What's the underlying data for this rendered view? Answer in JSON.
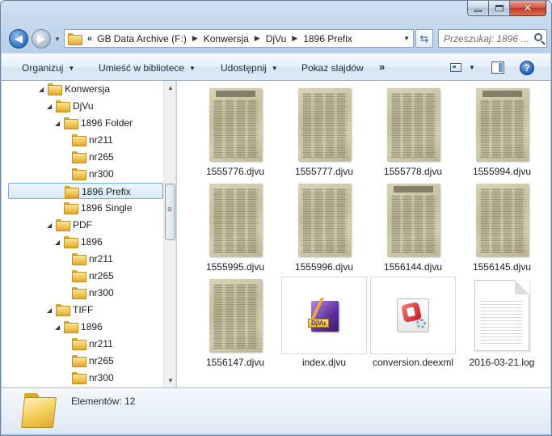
{
  "address": {
    "crumbs": [
      "GB Data Archive (F:)",
      "Konwersja",
      "DjVu",
      "1896 Prefix"
    ]
  },
  "search": {
    "placeholder": "Przeszukaj: 1896 ..."
  },
  "toolbar": {
    "organize": "Organizuj",
    "include_library": "Umieść w bibliotece",
    "share": "Udostępnij",
    "slideshow": "Pokaz slajdów"
  },
  "tree": [
    {
      "label": "Konwersja",
      "level": 0,
      "expanded": true
    },
    {
      "label": "DjVu",
      "level": 1,
      "expanded": true
    },
    {
      "label": "1896 Folder",
      "level": 2,
      "expanded": true
    },
    {
      "label": "nr211",
      "level": 3
    },
    {
      "label": "nr265",
      "level": 3
    },
    {
      "label": "nr300",
      "level": 3
    },
    {
      "label": "1896 Prefix",
      "level": 2,
      "selected": true
    },
    {
      "label": "1896 Single",
      "level": 2
    },
    {
      "label": "PDF",
      "level": 1,
      "expanded": true
    },
    {
      "label": "1896",
      "level": 2,
      "expanded": true
    },
    {
      "label": "nr211",
      "level": 3
    },
    {
      "label": "nr265",
      "level": 3
    },
    {
      "label": "nr300",
      "level": 3
    },
    {
      "label": "TIFF",
      "level": 1,
      "expanded": true
    },
    {
      "label": "1896",
      "level": 2,
      "expanded": true
    },
    {
      "label": "nr211",
      "level": 3
    },
    {
      "label": "nr265",
      "level": 3
    },
    {
      "label": "nr300",
      "level": 3
    }
  ],
  "files": [
    {
      "name": "1555776.djvu",
      "kind": "newspaper"
    },
    {
      "name": "1555777.djvu",
      "kind": "newspaper-plain"
    },
    {
      "name": "1555778.djvu",
      "kind": "newspaper-plain"
    },
    {
      "name": "1555994.djvu",
      "kind": "newspaper"
    },
    {
      "name": "1555995.djvu",
      "kind": "newspaper-plain"
    },
    {
      "name": "1555996.djvu",
      "kind": "newspaper-plain"
    },
    {
      "name": "1556144.djvu",
      "kind": "newspaper"
    },
    {
      "name": "1556145.djvu",
      "kind": "newspaper-plain"
    },
    {
      "name": "1556147.djvu",
      "kind": "newspaper-plain"
    },
    {
      "name": "index.djvu",
      "kind": "djvu"
    },
    {
      "name": "conversion.deexml",
      "kind": "deex"
    },
    {
      "name": "2016-03-21.log",
      "kind": "log"
    }
  ],
  "djvu_badge": "DjVu",
  "status": {
    "count_text": "Elementów: 12"
  }
}
